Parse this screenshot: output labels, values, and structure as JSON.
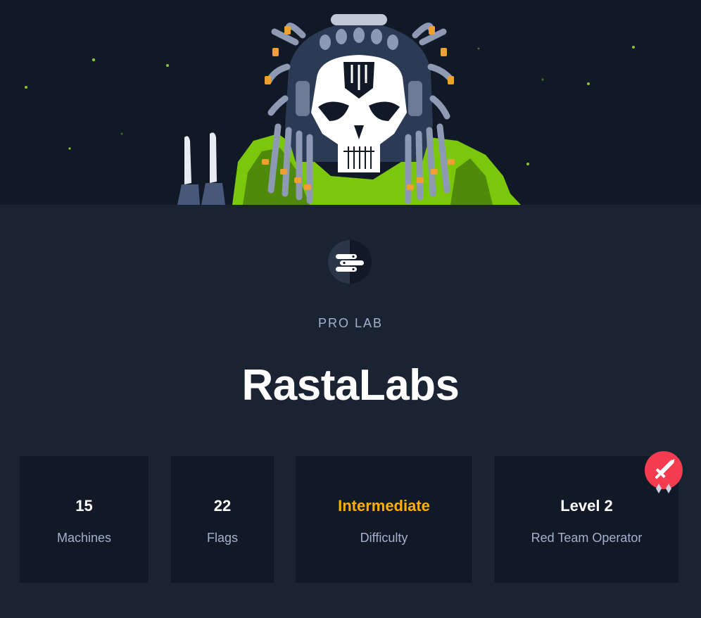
{
  "hero": {
    "mascot_icon": "skull-rastalabs-mascot"
  },
  "lab": {
    "logo_icon": "rastalabs-logo-icon",
    "eyebrow": "PRO LAB",
    "title": "RastaLabs"
  },
  "stats": [
    {
      "value": "15",
      "label": "Machines"
    },
    {
      "value": "22",
      "label": "Flags"
    },
    {
      "value": "Intermediate",
      "label": "Difficulty",
      "color": "#ffaf00"
    },
    {
      "value": "Level 2",
      "label": "Red Team Operator"
    }
  ],
  "badge": {
    "icon": "red-team-sword-badge-icon",
    "color": "#f43b50"
  }
}
